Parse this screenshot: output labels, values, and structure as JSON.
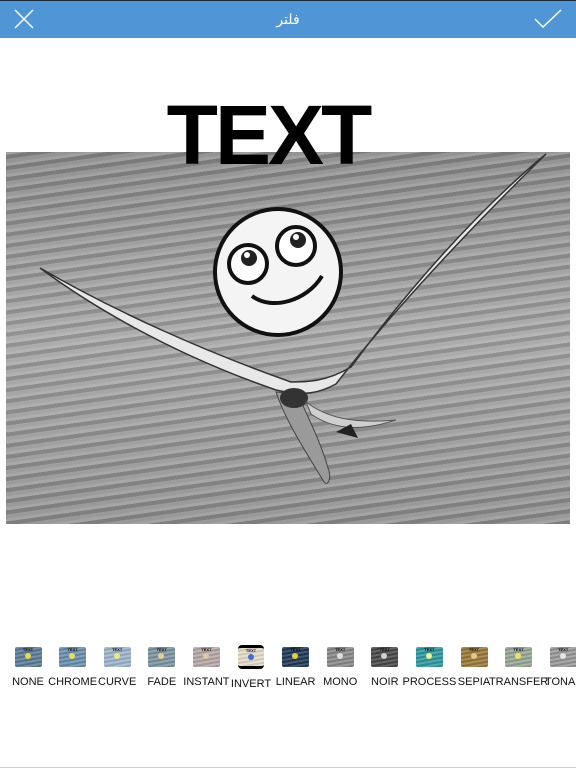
{
  "header": {
    "title": "فلتر",
    "close_icon": "close-icon",
    "confirm_icon": "checkmark-icon",
    "background": "#5096d6"
  },
  "editor": {
    "sticker_text": "TEXT",
    "filter_applied": "MONO"
  },
  "filters": [
    {
      "label": "NONE",
      "color": "#5b7e99",
      "dot": "#e8d84a"
    },
    {
      "label": "CHROME",
      "color": "#6a8fb0",
      "dot": "#eadf55"
    },
    {
      "label": "CURVE",
      "color": "#9eb7cc",
      "dot": "#efe77a"
    },
    {
      "label": "FADE",
      "color": "#7d95a3",
      "dot": "#e3cf8a"
    },
    {
      "label": "INSTANT",
      "color": "#b8a8a8",
      "dot": "#dcc9a0"
    },
    {
      "label": "INVERT",
      "color": "#e8dccb",
      "dot": "#3c6ee0",
      "selected": true
    },
    {
      "label": "LINEAR",
      "color": "#203a5a",
      "dot": "#e8d030"
    },
    {
      "label": "MONO",
      "color": "#8a8a8a",
      "dot": "#e0e0e0"
    },
    {
      "label": "NOIR",
      "color": "#4a4a4a",
      "dot": "#cfcfcf"
    },
    {
      "label": "PROCESS",
      "color": "#2f9aa0",
      "dot": "#f4ef90"
    },
    {
      "label": "SEPIA",
      "color": "#9a7a3a",
      "dot": "#e8c880"
    },
    {
      "label": "TRANSFER",
      "color": "#98a898",
      "dot": "#f0e060"
    },
    {
      "label": "TONAL",
      "color": "#9a9a9a",
      "dot": "#e6e6e6"
    }
  ]
}
